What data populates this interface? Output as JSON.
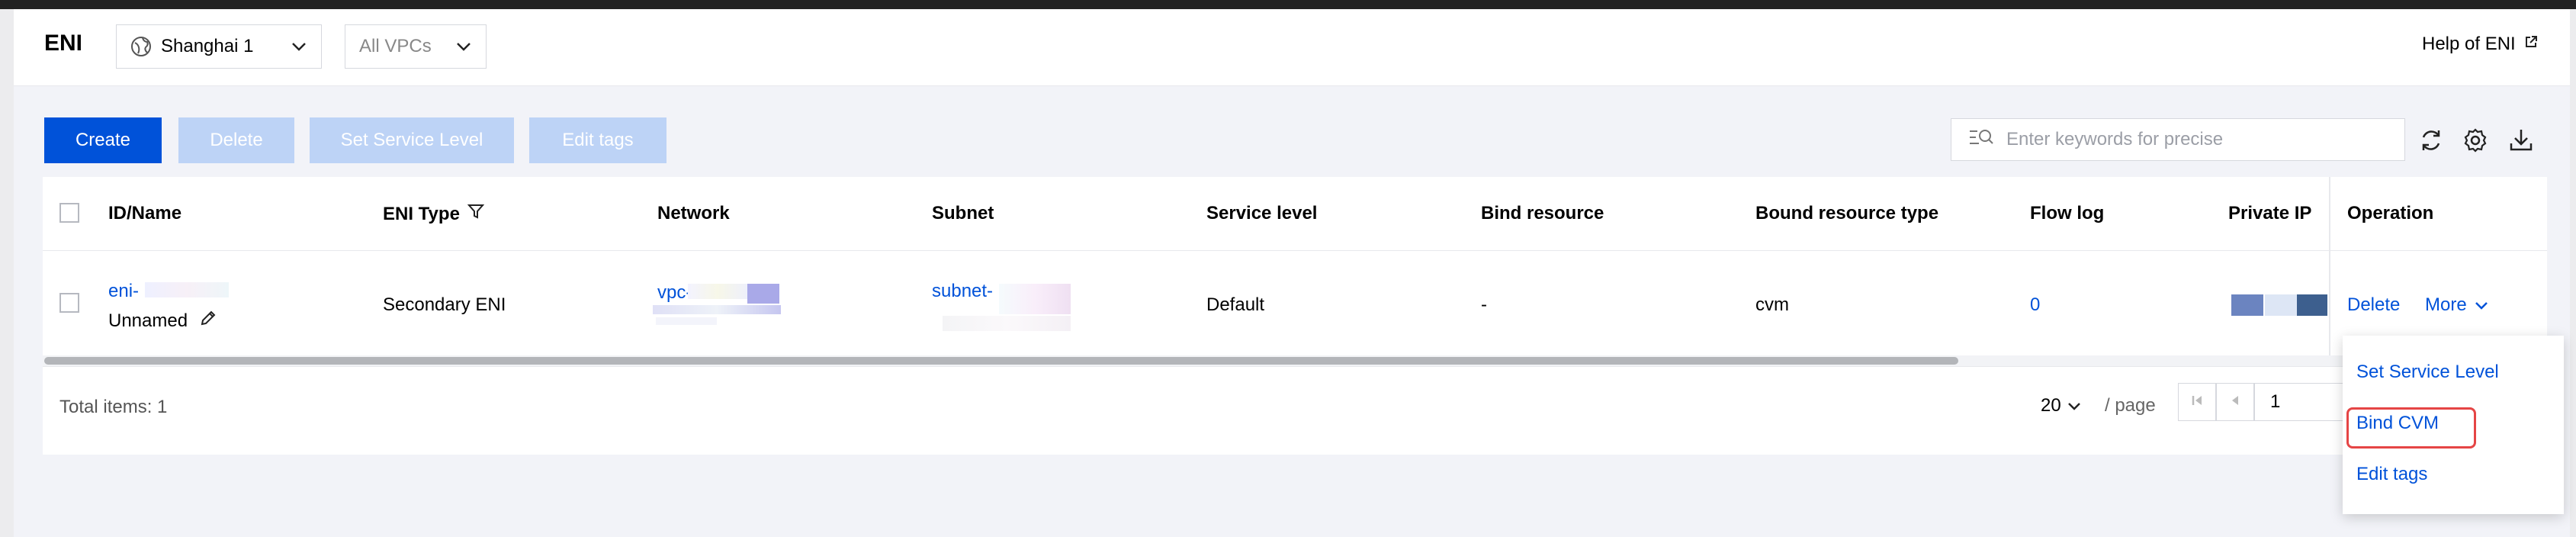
{
  "header": {
    "title": "ENI",
    "region": "Shanghai 1",
    "vpc_filter": "All VPCs",
    "help": "Help of ENI"
  },
  "toolbar": {
    "create": "Create",
    "delete": "Delete",
    "set_service_level": "Set Service Level",
    "edit_tags": "Edit tags",
    "search_placeholder": "Enter keywords for precise"
  },
  "table": {
    "columns": [
      "ID/Name",
      "ENI Type",
      "Network",
      "Subnet",
      "Service level",
      "Bind resource",
      "Bound resource type",
      "Flow log",
      "Private IP",
      "Operation"
    ],
    "rows": [
      {
        "id": "eni-",
        "name": "Unnamed",
        "eni_type": "Secondary ENI",
        "network": "vpc-",
        "subnet": "subnet-",
        "service_level": "Default",
        "bind_resource": "-",
        "bound_resource_type": "cvm",
        "flow_log": "0",
        "op_delete": "Delete",
        "op_more": "More"
      }
    ],
    "total": "Total items: 1",
    "page_size": "20",
    "per_page": "/ page",
    "page": "1"
  },
  "more_menu": {
    "items": [
      "Set Service Level",
      "Bind CVM",
      "Edit tags"
    ]
  },
  "colors": {
    "primary": "#0052d9",
    "disabled": "#bdd3f6",
    "highlight": "#e54545"
  }
}
